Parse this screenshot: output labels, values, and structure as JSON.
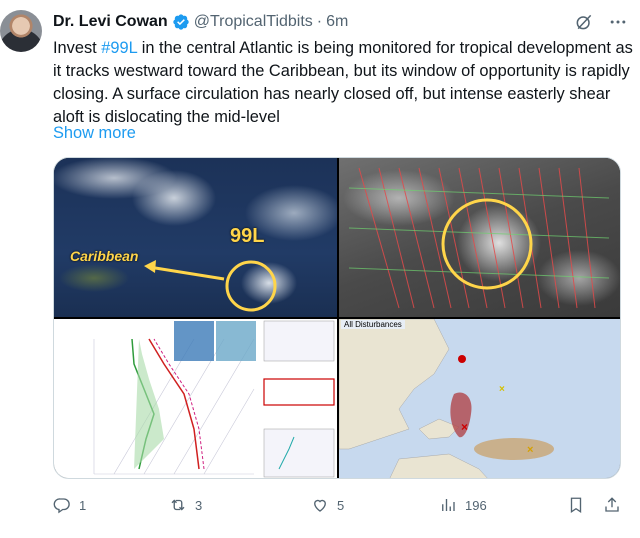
{
  "tweet": {
    "author_name": "Dr. Levi Cowan",
    "handle": "@TropicalTidbits",
    "separator": "·",
    "time": "6m",
    "text_before": "Invest ",
    "hashtag": "#99L",
    "text_after": " in the central Atlantic is being monitored for tropical development as it tracks westward toward the Caribbean, but its window of opportunity is rapidly closing. A surface circulation has nearly closed off, but intense easterly shear aloft is dislocating the mid-level",
    "show_more": "Show more"
  },
  "media": {
    "panel1": {
      "label_region": "Caribbean",
      "label_system": "99L"
    },
    "panel4": {
      "title": "All Disturbances"
    }
  },
  "actions": {
    "replies": "1",
    "reposts": "3",
    "likes": "5",
    "views": "196"
  },
  "colors": {
    "accent": "#1d9bf0",
    "muted": "#536471",
    "highlight_yellow": "#ffd54a"
  },
  "icons": [
    "verified-badge-icon",
    "grok-icon",
    "more-icon",
    "reply-icon",
    "repost-icon",
    "like-icon",
    "views-icon",
    "bookmark-icon",
    "share-icon"
  ]
}
